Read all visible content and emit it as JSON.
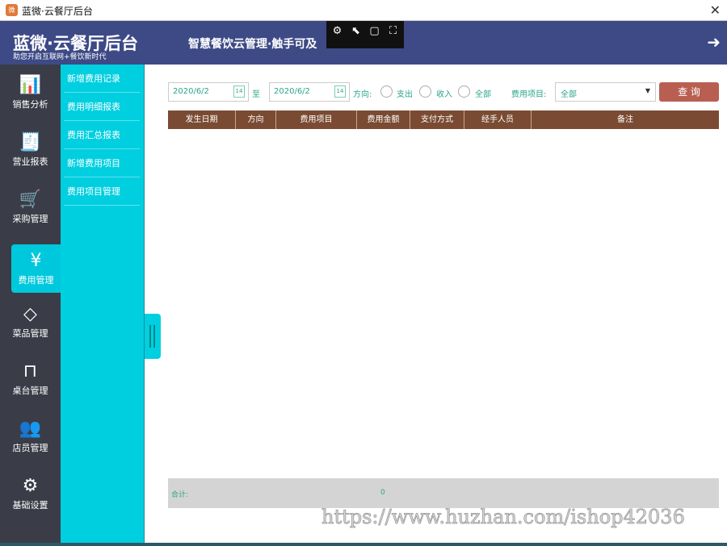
{
  "window": {
    "title": "蓝微·云餐厅后台",
    "logo": "微",
    "close": "✕"
  },
  "header": {
    "brand": "蓝微·云餐厅后台",
    "subtitle": "助您开启互联网+餐饮新时代",
    "slogan": "智慧餐饮云管理·触手可及",
    "tools": [
      "settings-icon",
      "pointer-icon",
      "fullscreen-icon",
      "region-select-icon"
    ],
    "exit_icon": "exit-icon"
  },
  "nav": [
    {
      "label": "销售分析",
      "icon": "📊"
    },
    {
      "label": "营业报表",
      "icon": "🧾"
    },
    {
      "label": "采购管理",
      "icon": "🛒"
    },
    {
      "label": "费用管理",
      "icon": "¥",
      "active": true
    },
    {
      "label": "菜品管理",
      "icon": "◇"
    },
    {
      "label": "桌台管理",
      "icon": "⊓"
    },
    {
      "label": "店员管理",
      "icon": "👥"
    },
    {
      "label": "基础设置",
      "icon": "⚙"
    }
  ],
  "submenu": [
    "新增费用记录",
    "费用明细报表",
    "费用汇总报表",
    "新增费用项目",
    "费用项目管理"
  ],
  "filters": {
    "start_date": "2020/6/2",
    "to": "至",
    "end_date": "2020/6/2",
    "calendar_day": "14",
    "direction_label": "方向:",
    "options": [
      "支出",
      "收入",
      "全部"
    ],
    "item_label": "费用项目:",
    "item_value": "全部",
    "query": "查 询"
  },
  "table": {
    "columns": [
      "发生日期",
      "方向",
      "费用项目",
      "费用金额",
      "支付方式",
      "经手人员",
      "备注"
    ]
  },
  "footer": {
    "total_label": "合计:",
    "total_value": "0"
  },
  "watermark": "https://www.huzhan.com/ishop42036",
  "colors": {
    "header": "#3d4a86",
    "nav": "#3a3d47",
    "accent": "#00cfe0",
    "table_header": "#7a4b32",
    "button": "#b85f52"
  }
}
